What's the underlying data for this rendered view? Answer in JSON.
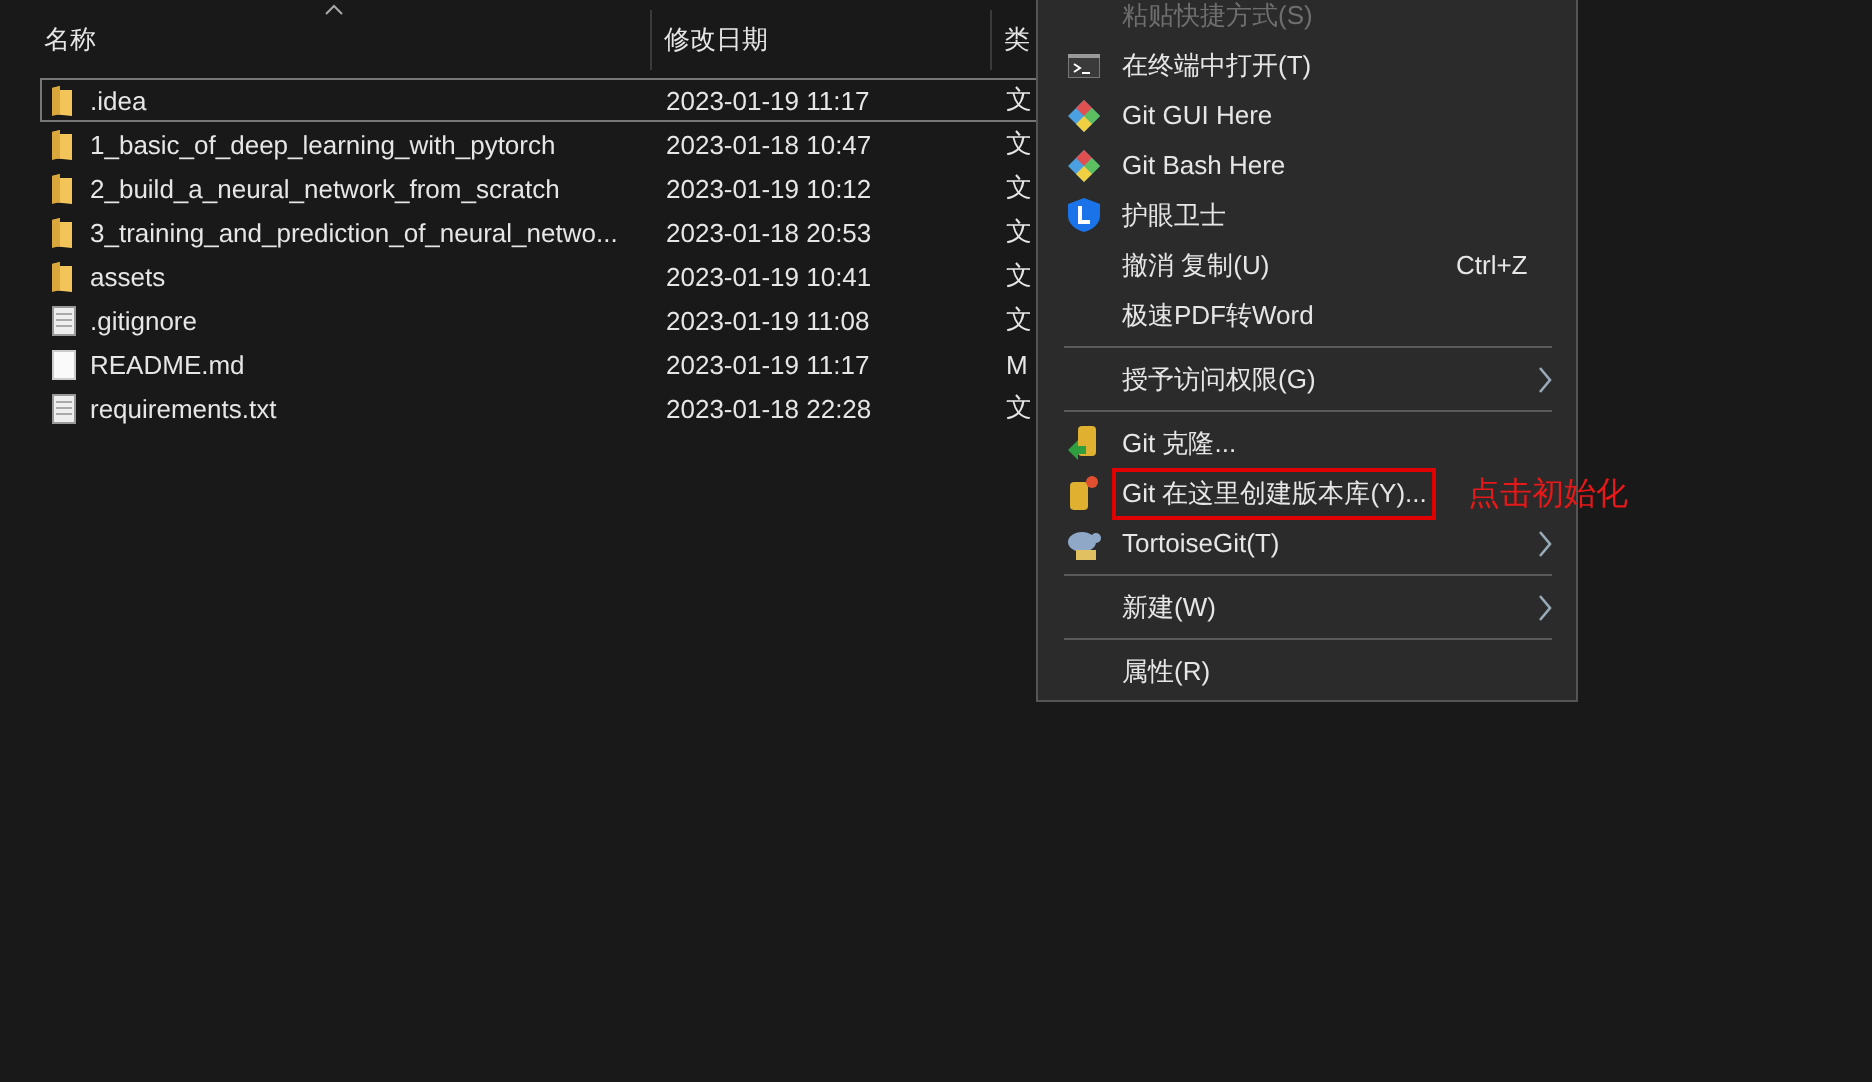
{
  "columns": [
    {
      "label": "名称",
      "sorted": true
    },
    {
      "label": "修改日期",
      "sorted": false
    },
    {
      "label": "类",
      "sorted": false
    }
  ],
  "files": [
    {
      "name": ".idea",
      "modified": "2023-01-19 11:17",
      "type": "文",
      "kind": "folder",
      "selected": true
    },
    {
      "name": "1_basic_of_deep_learning_with_pytorch",
      "modified": "2023-01-18 10:47",
      "type": "文",
      "kind": "folder",
      "selected": false
    },
    {
      "name": "2_build_a_neural_network_from_scratch",
      "modified": "2023-01-19 10:12",
      "type": "文",
      "kind": "folder",
      "selected": false
    },
    {
      "name": "3_training_and_prediction_of_neural_netwo...",
      "modified": "2023-01-18 20:53",
      "type": "文",
      "kind": "folder",
      "selected": false
    },
    {
      "name": "assets",
      "modified": "2023-01-19 10:41",
      "type": "文",
      "kind": "folder",
      "selected": false
    },
    {
      "name": ".gitignore",
      "modified": "2023-01-19 11:08",
      "type": "文",
      "kind": "file",
      "selected": false
    },
    {
      "name": "README.md",
      "modified": "2023-01-19 11:17",
      "type": "M",
      "kind": "document",
      "selected": false
    },
    {
      "name": "requirements.txt",
      "modified": "2023-01-18 22:28",
      "type": "文",
      "kind": "file",
      "selected": false
    }
  ],
  "context_menu": [
    {
      "kind": "item",
      "label": "粘贴快捷方式(S)",
      "disabled": true,
      "boxed": false
    },
    {
      "kind": "item",
      "label": "在终端中打开(T)",
      "disabled": false,
      "boxed": false
    },
    {
      "kind": "item",
      "label": "Git GUI Here",
      "disabled": false,
      "boxed": false
    },
    {
      "kind": "item",
      "label": "Git Bash Here",
      "disabled": false,
      "boxed": false
    },
    {
      "kind": "item",
      "label": "护眼卫士",
      "disabled": false,
      "boxed": false
    },
    {
      "kind": "item",
      "label": "撤消 复制(U)",
      "shortcut": "Ctrl+Z",
      "disabled": false,
      "boxed": false
    },
    {
      "kind": "item",
      "label": "极速PDF转Word",
      "disabled": false,
      "boxed": false
    },
    {
      "kind": "separator"
    },
    {
      "kind": "submenu",
      "label": "授予访问权限(G)",
      "disabled": false,
      "boxed": false
    },
    {
      "kind": "separator"
    },
    {
      "kind": "item",
      "label": "Git 克隆...",
      "disabled": false,
      "boxed": false
    },
    {
      "kind": "item",
      "label": "Git 在这里创建版本库(Y)...",
      "disabled": false,
      "boxed": true
    },
    {
      "kind": "submenu",
      "label": "TortoiseGit(T)",
      "disabled": false,
      "boxed": false
    },
    {
      "kind": "separator"
    },
    {
      "kind": "submenu",
      "label": "新建(W)",
      "disabled": false,
      "boxed": false
    },
    {
      "kind": "separator"
    },
    {
      "kind": "item",
      "label": "属性(R)",
      "disabled": false,
      "boxed": false
    }
  ],
  "annotation": {
    "text": "点击初始化"
  }
}
